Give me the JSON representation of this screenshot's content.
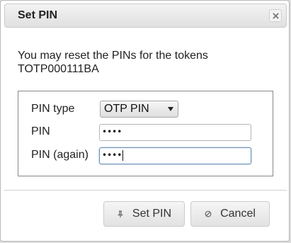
{
  "dialog": {
    "title": "Set PIN",
    "close_icon": "close-icon",
    "message": "You may reset the PINs for the tokens TOTP000111BA"
  },
  "form": {
    "pin_type_label": "PIN type",
    "pin_type_value": "OTP PIN",
    "pin_label": "PIN",
    "pin_value": "••••",
    "pin_again_label": "PIN (again)",
    "pin_again_value": "••••"
  },
  "buttons": {
    "set_pin_label": "Set PIN",
    "set_pin_icon": "pin-icon",
    "cancel_label": "Cancel",
    "cancel_icon": "cancel-icon"
  }
}
